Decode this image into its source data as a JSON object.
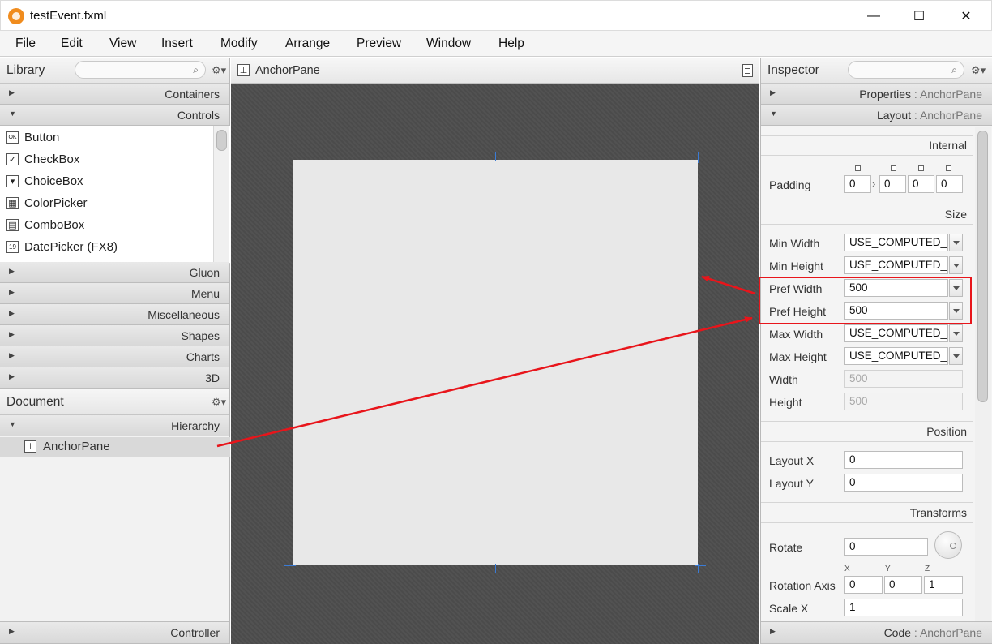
{
  "window": {
    "title": "testEvent.fxml",
    "minimize": "—",
    "maximize": "☐",
    "close": "✕"
  },
  "menu": [
    "File",
    "Edit",
    "View",
    "Insert",
    "Modify",
    "Arrange",
    "Preview",
    "Window",
    "Help"
  ],
  "library": {
    "title": "Library",
    "sections_top": [
      {
        "label": "Containers",
        "expanded": false
      },
      {
        "label": "Controls",
        "expanded": true
      }
    ],
    "controls": [
      {
        "label": "Button",
        "icon": "OK"
      },
      {
        "label": "CheckBox",
        "icon": "✓"
      },
      {
        "label": "ChoiceBox",
        "icon": "▾"
      },
      {
        "label": "ColorPicker",
        "icon": "▦"
      },
      {
        "label": "ComboBox",
        "icon": "▤"
      },
      {
        "label": "DatePicker  (FX8)",
        "icon": "19"
      }
    ],
    "sections_bottom": [
      {
        "label": "Gluon"
      },
      {
        "label": "Menu"
      },
      {
        "label": "Miscellaneous"
      },
      {
        "label": "Shapes"
      },
      {
        "label": "Charts"
      },
      {
        "label": "3D"
      }
    ]
  },
  "document": {
    "title": "Document",
    "hierarchy_label": "Hierarchy",
    "hierarchy_item": "AnchorPane",
    "controller_label": "Controller"
  },
  "canvas": {
    "title": "AnchorPane"
  },
  "inspector": {
    "title": "Inspector",
    "properties": {
      "label": "Properties",
      "sep": " : ",
      "target": "AnchorPane"
    },
    "layout": {
      "label": "Layout",
      "sep": " : ",
      "target": "AnchorPane"
    },
    "code": {
      "label": "Code",
      "sep": " : ",
      "target": "AnchorPane"
    },
    "internal_label": "Internal",
    "padding": {
      "label": "Padding",
      "values": [
        "0",
        "0",
        "0",
        "0"
      ],
      "link": "›"
    },
    "size_label": "Size",
    "size_fields": [
      {
        "label": "Min Width",
        "value": "USE_COMPUTED_SIZE",
        "dropdown": true,
        "disabled": false
      },
      {
        "label": "Min Height",
        "value": "USE_COMPUTED_SIZE",
        "dropdown": true,
        "disabled": false
      },
      {
        "label": "Pref Width",
        "value": "500",
        "dropdown": true,
        "disabled": false
      },
      {
        "label": "Pref Height",
        "value": "500",
        "dropdown": true,
        "disabled": false
      },
      {
        "label": "Max Width",
        "value": "USE_COMPUTED_SIZE",
        "dropdown": true,
        "disabled": false
      },
      {
        "label": "Max Height",
        "value": "USE_COMPUTED_SIZE",
        "dropdown": true,
        "disabled": false
      },
      {
        "label": "Width",
        "value": "500",
        "dropdown": false,
        "disabled": true
      },
      {
        "label": "Height",
        "value": "500",
        "dropdown": false,
        "disabled": true
      }
    ],
    "position_label": "Position",
    "layout_x": {
      "label": "Layout X",
      "value": "0"
    },
    "layout_y": {
      "label": "Layout Y",
      "value": "0"
    },
    "transforms_label": "Transforms",
    "rotate": {
      "label": "Rotate",
      "value": "0"
    },
    "rotation_axis": {
      "label": "Rotation Axis",
      "axes": [
        "X",
        "Y",
        "Z"
      ],
      "values": [
        "0",
        "0",
        "1"
      ]
    },
    "scale_x": {
      "label": "Scale X",
      "value": "1"
    }
  },
  "colors": {
    "annotation": "#e8151b",
    "canvas_bg": "#4b4b4b",
    "handle": "#3a7bd5"
  }
}
